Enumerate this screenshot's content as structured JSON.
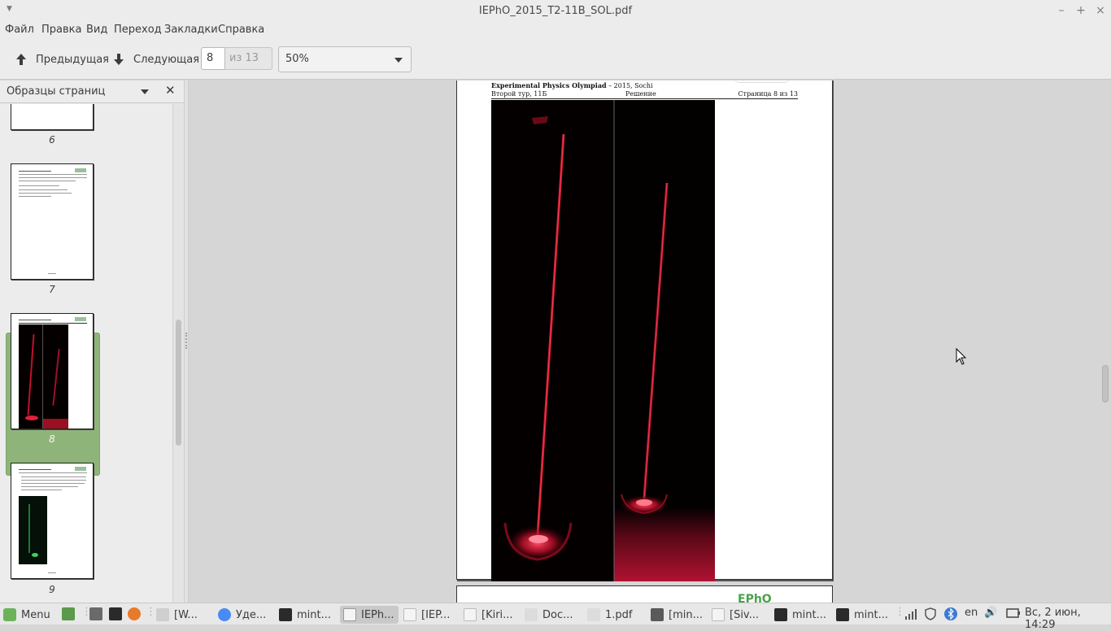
{
  "window": {
    "title": "IEPhO_2015_T2-11B_SOL.pdf"
  },
  "menubar": {
    "items": [
      "Файл",
      "Правка",
      "Вид",
      "Переход",
      "Закладки",
      "Справка"
    ]
  },
  "toolbar": {
    "prev_label": "Предыдущая",
    "next_label": "Следующая",
    "page_value": "8",
    "page_of": "из 13",
    "zoom_value": "50%"
  },
  "sidebar": {
    "title": "Образцы страниц",
    "thumbnails": [
      {
        "number": "6"
      },
      {
        "number": "7"
      },
      {
        "number": "8",
        "selected": true
      },
      {
        "number": "9"
      }
    ]
  },
  "document": {
    "header_title": "Experimental Physics Olympiad",
    "header_suffix": "– 2015, Sochi",
    "header_round": "Второй тур, 11Б",
    "header_section": "Решение",
    "header_page": "Страница 8 из 13",
    "next_page_logo": "EPhO"
  },
  "taskbar": {
    "menu_label": "Menu",
    "items": [
      "[W...",
      "Уде...",
      "mint...",
      "IEPh...",
      "[IEP...",
      "[Kiri...",
      "Doc...",
      "1.pdf",
      "[min...",
      "[Siv...",
      "mint...",
      "mint..."
    ],
    "lang": "en",
    "clock": "Вс, 2 июн, 14:29"
  },
  "colors": {
    "accent_selected": "#8fb47a",
    "panel_bg": "#ececec",
    "canvas_bg": "#d6d6d6",
    "mint_green": "#6cb25a"
  }
}
